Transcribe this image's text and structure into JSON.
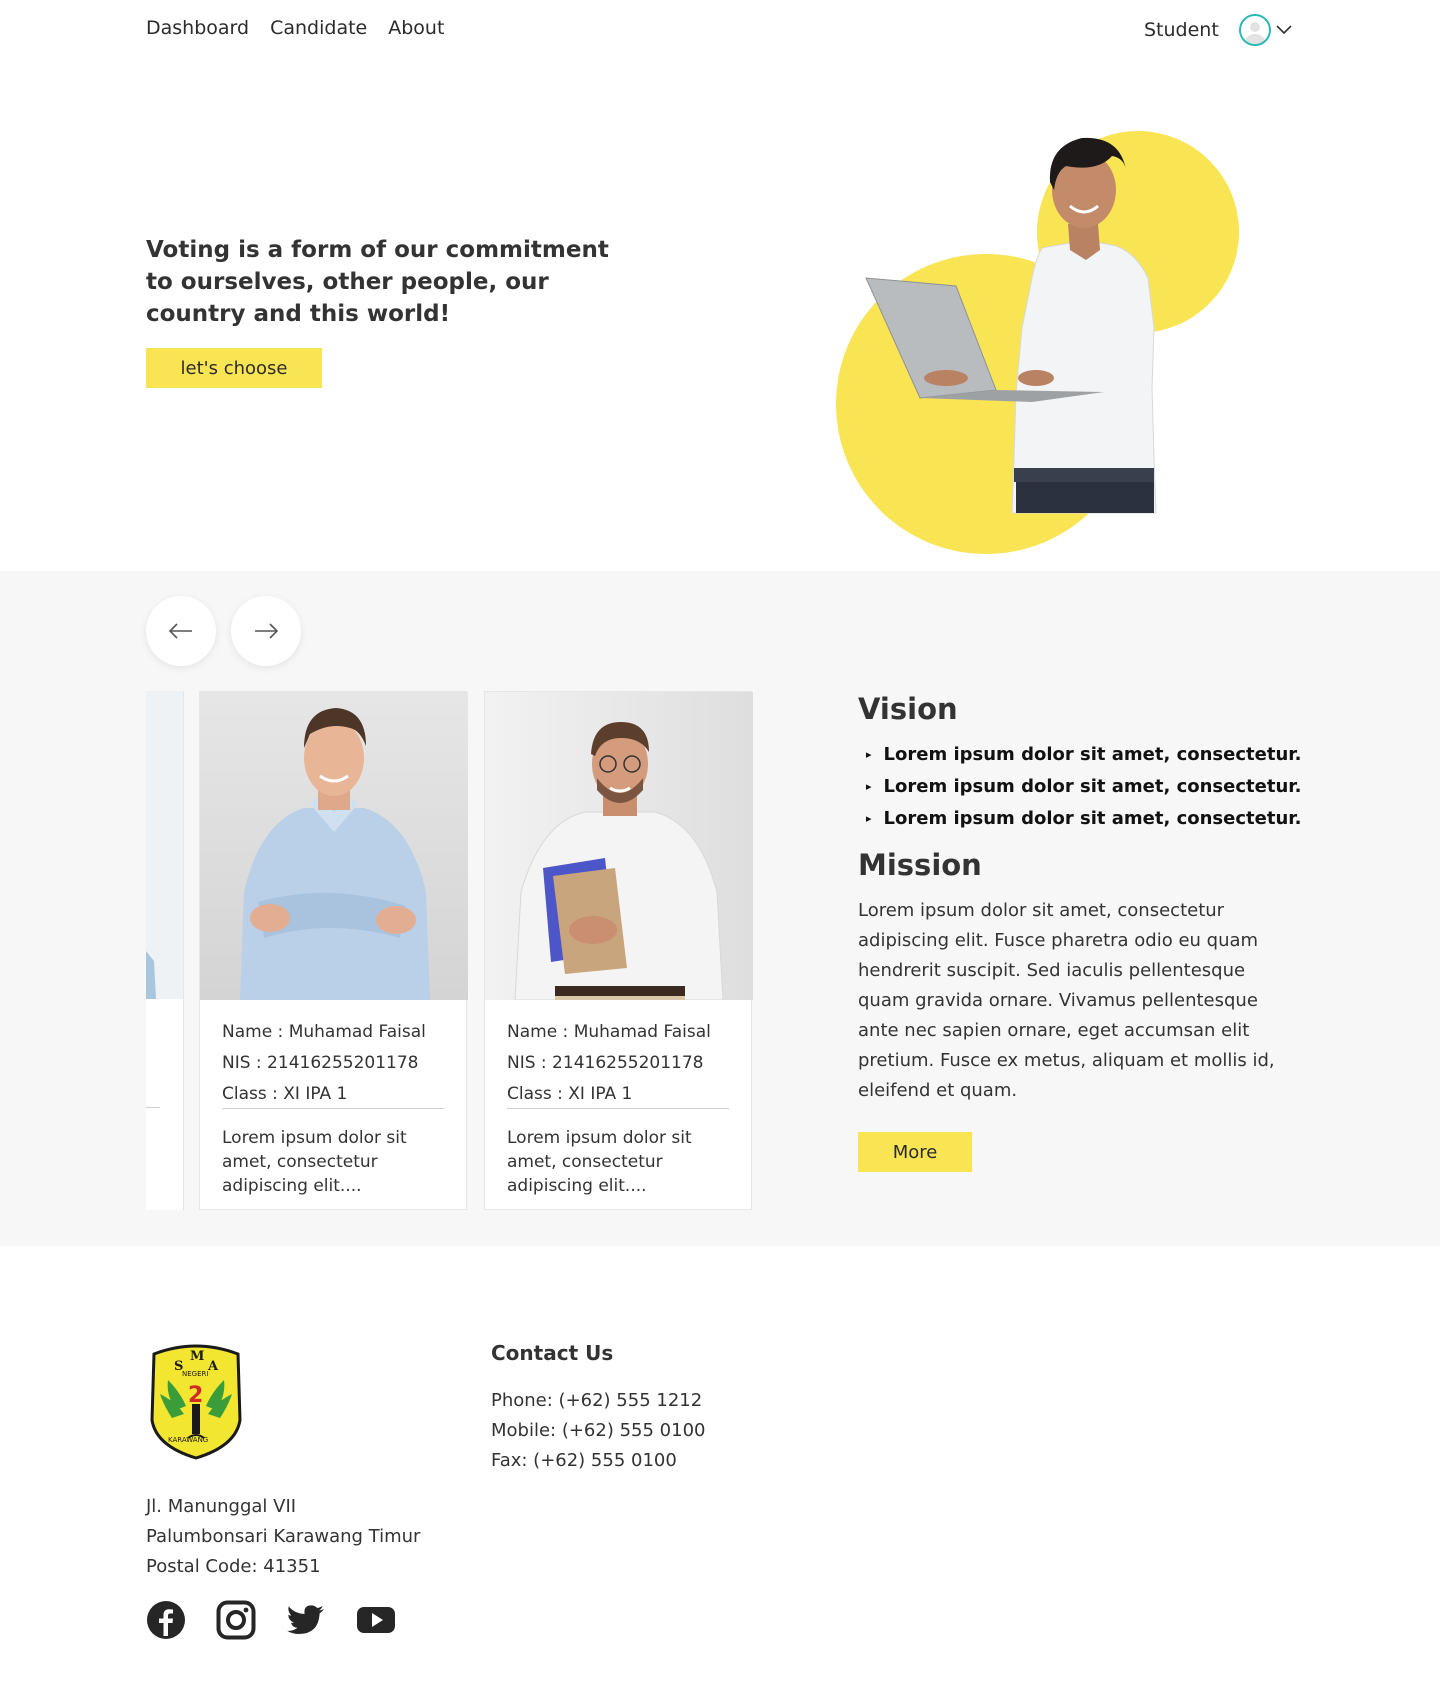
{
  "nav": {
    "links": [
      "Dashboard",
      "Candidate",
      "About"
    ],
    "user_role": "Student"
  },
  "hero": {
    "headline": "Voting is a form of our commitment to ourselves, other people, our country and this world!",
    "button_label": "let's choose"
  },
  "candidates": [
    {
      "name_label": "Name : Muhamad  Faisal",
      "nis_label": "NIS : 21416255201178",
      "class_label": "Class : XI IPA 1",
      "description": "Lorem ipsum dolor sit amet, consectetur adipiscing elit...."
    },
    {
      "name_label": "Name : Muhamad  Faisal",
      "nis_label": "NIS : 21416255201178",
      "class_label": "Class : XI IPA 1",
      "description": "Lorem ipsum dolor sit amet, consectetur adipiscing elit...."
    }
  ],
  "vision": {
    "title": "Vision",
    "items": [
      "Lorem ipsum dolor sit amet, consectetur.",
      "Lorem ipsum dolor sit amet, consectetur.",
      "Lorem ipsum dolor sit amet, consectetur."
    ]
  },
  "mission": {
    "title": "Mission",
    "text": "Lorem ipsum dolor sit amet, consectetur adipiscing elit. Fusce pharetra odio eu quam hendrerit suscipit. Sed iaculis pellentesque quam gravida ornare. Vivamus pellentesque ante nec sapien ornare, eget accumsan elit pretium. Fusce ex metus, aliquam et mollis id, eleifend et quam.",
    "button_label": "More"
  },
  "footer": {
    "logo_text": [
      "S",
      "M",
      "A",
      "NEGERI",
      "2",
      "KARAWANG"
    ],
    "address": [
      "Jl. Manunggal  VII",
      "Palumbonsari Karawang Timur",
      "Postal Code: 41351"
    ],
    "contact_title": "Contact Us",
    "contacts": [
      "Phone: (+62) 555 1212",
      "Mobile: (+62) 555 0100",
      "Fax: (+62) 555 0100"
    ],
    "social_icons": [
      "facebook-icon",
      "instagram-icon",
      "twitter-icon",
      "youtube-icon"
    ]
  },
  "colors": {
    "accent": "#f9e453",
    "avatar_ring": "#2bb9b3",
    "section_bg": "#f7f7f7"
  }
}
